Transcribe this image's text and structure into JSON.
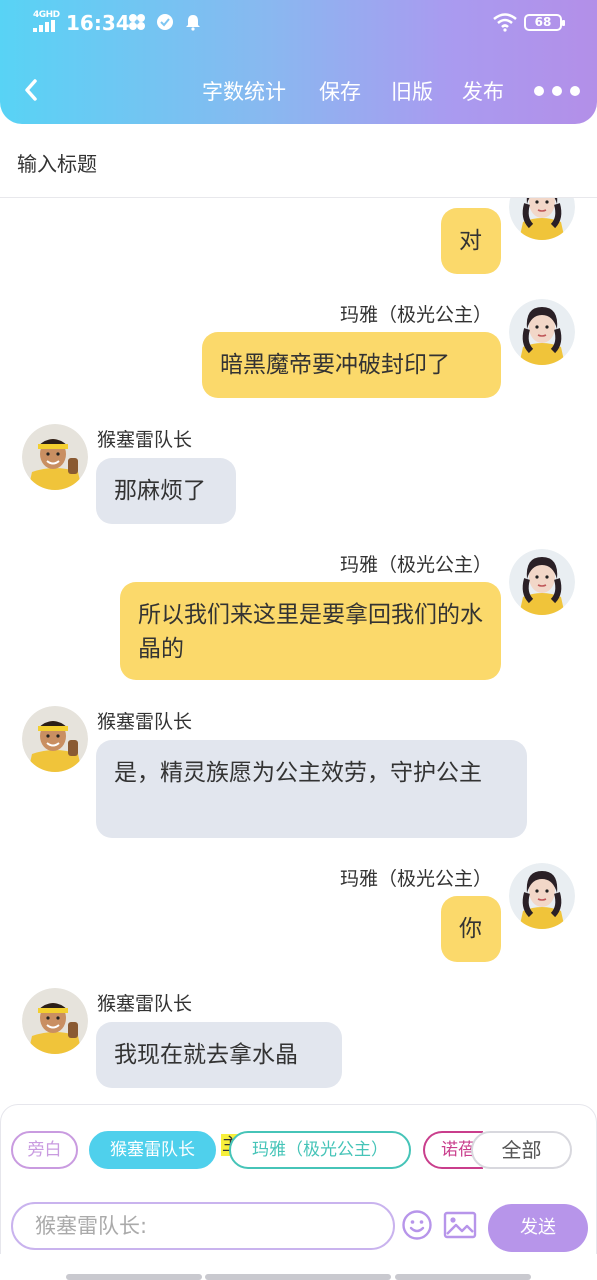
{
  "status_bar": {
    "network": "4GHD",
    "time": "16:34",
    "battery": "68",
    "icons": [
      "signal-icon",
      "pinwheel-icon",
      "check-circle-icon",
      "bell-icon",
      "wifi-icon",
      "battery-icon"
    ]
  },
  "nav": {
    "back_icon": "chevron-left-icon",
    "items": [
      "字数统计",
      "保存",
      "旧版",
      "发布"
    ],
    "more_icon": "more-dots-icon"
  },
  "title_input": {
    "placeholder": "输入标题"
  },
  "characters": {
    "maya": {
      "name": "玛雅（极光公主）",
      "avatar": "maya-avatar"
    },
    "captain": {
      "name": "猴塞雷队长",
      "avatar": "captain-avatar"
    }
  },
  "messages": [
    {
      "speaker": "maya",
      "side": "right",
      "name": "",
      "text": "对"
    },
    {
      "speaker": "maya",
      "side": "right",
      "name": "玛雅（极光公主）",
      "text": "暗黑魔帝要冲破封印了"
    },
    {
      "speaker": "captain",
      "side": "left",
      "name": "猴塞雷队长",
      "text": "那麻烦了"
    },
    {
      "speaker": "maya",
      "side": "right",
      "name": "玛雅（极光公主）",
      "text": "所以我们来这里是要拿回我们的水晶的"
    },
    {
      "speaker": "captain",
      "side": "left",
      "name": "猴塞雷队长",
      "text": "是，精灵族愿为公主效劳，守护公主"
    },
    {
      "speaker": "maya",
      "side": "right",
      "name": "玛雅（极光公主）",
      "text": "你"
    },
    {
      "speaker": "captain",
      "side": "left",
      "name": "猴塞雷队长",
      "text": "我现在就去拿水晶"
    }
  ],
  "role_chips": {
    "narrator": "旁白",
    "captain": "猴塞雷队长",
    "maya": "玛雅（极光公主）",
    "partial": "诺蓓",
    "all": "全部",
    "highlight_char": "主",
    "colors": {
      "narrator": "#c99be0",
      "captain": "#4fd0ec",
      "maya": "#46c4b8",
      "partial": "#c93e8c"
    }
  },
  "composer": {
    "placeholder": "猴塞雷队长:",
    "emoji_icon": "emoji-icon",
    "image_icon": "image-icon",
    "send_label": "发送"
  },
  "colors": {
    "header_start": "#58d3f5",
    "header_end": "#b38fe8",
    "my_bubble": "#fbd96b",
    "other_bubble": "#e2e6ee",
    "send_button": "#b795ea"
  }
}
